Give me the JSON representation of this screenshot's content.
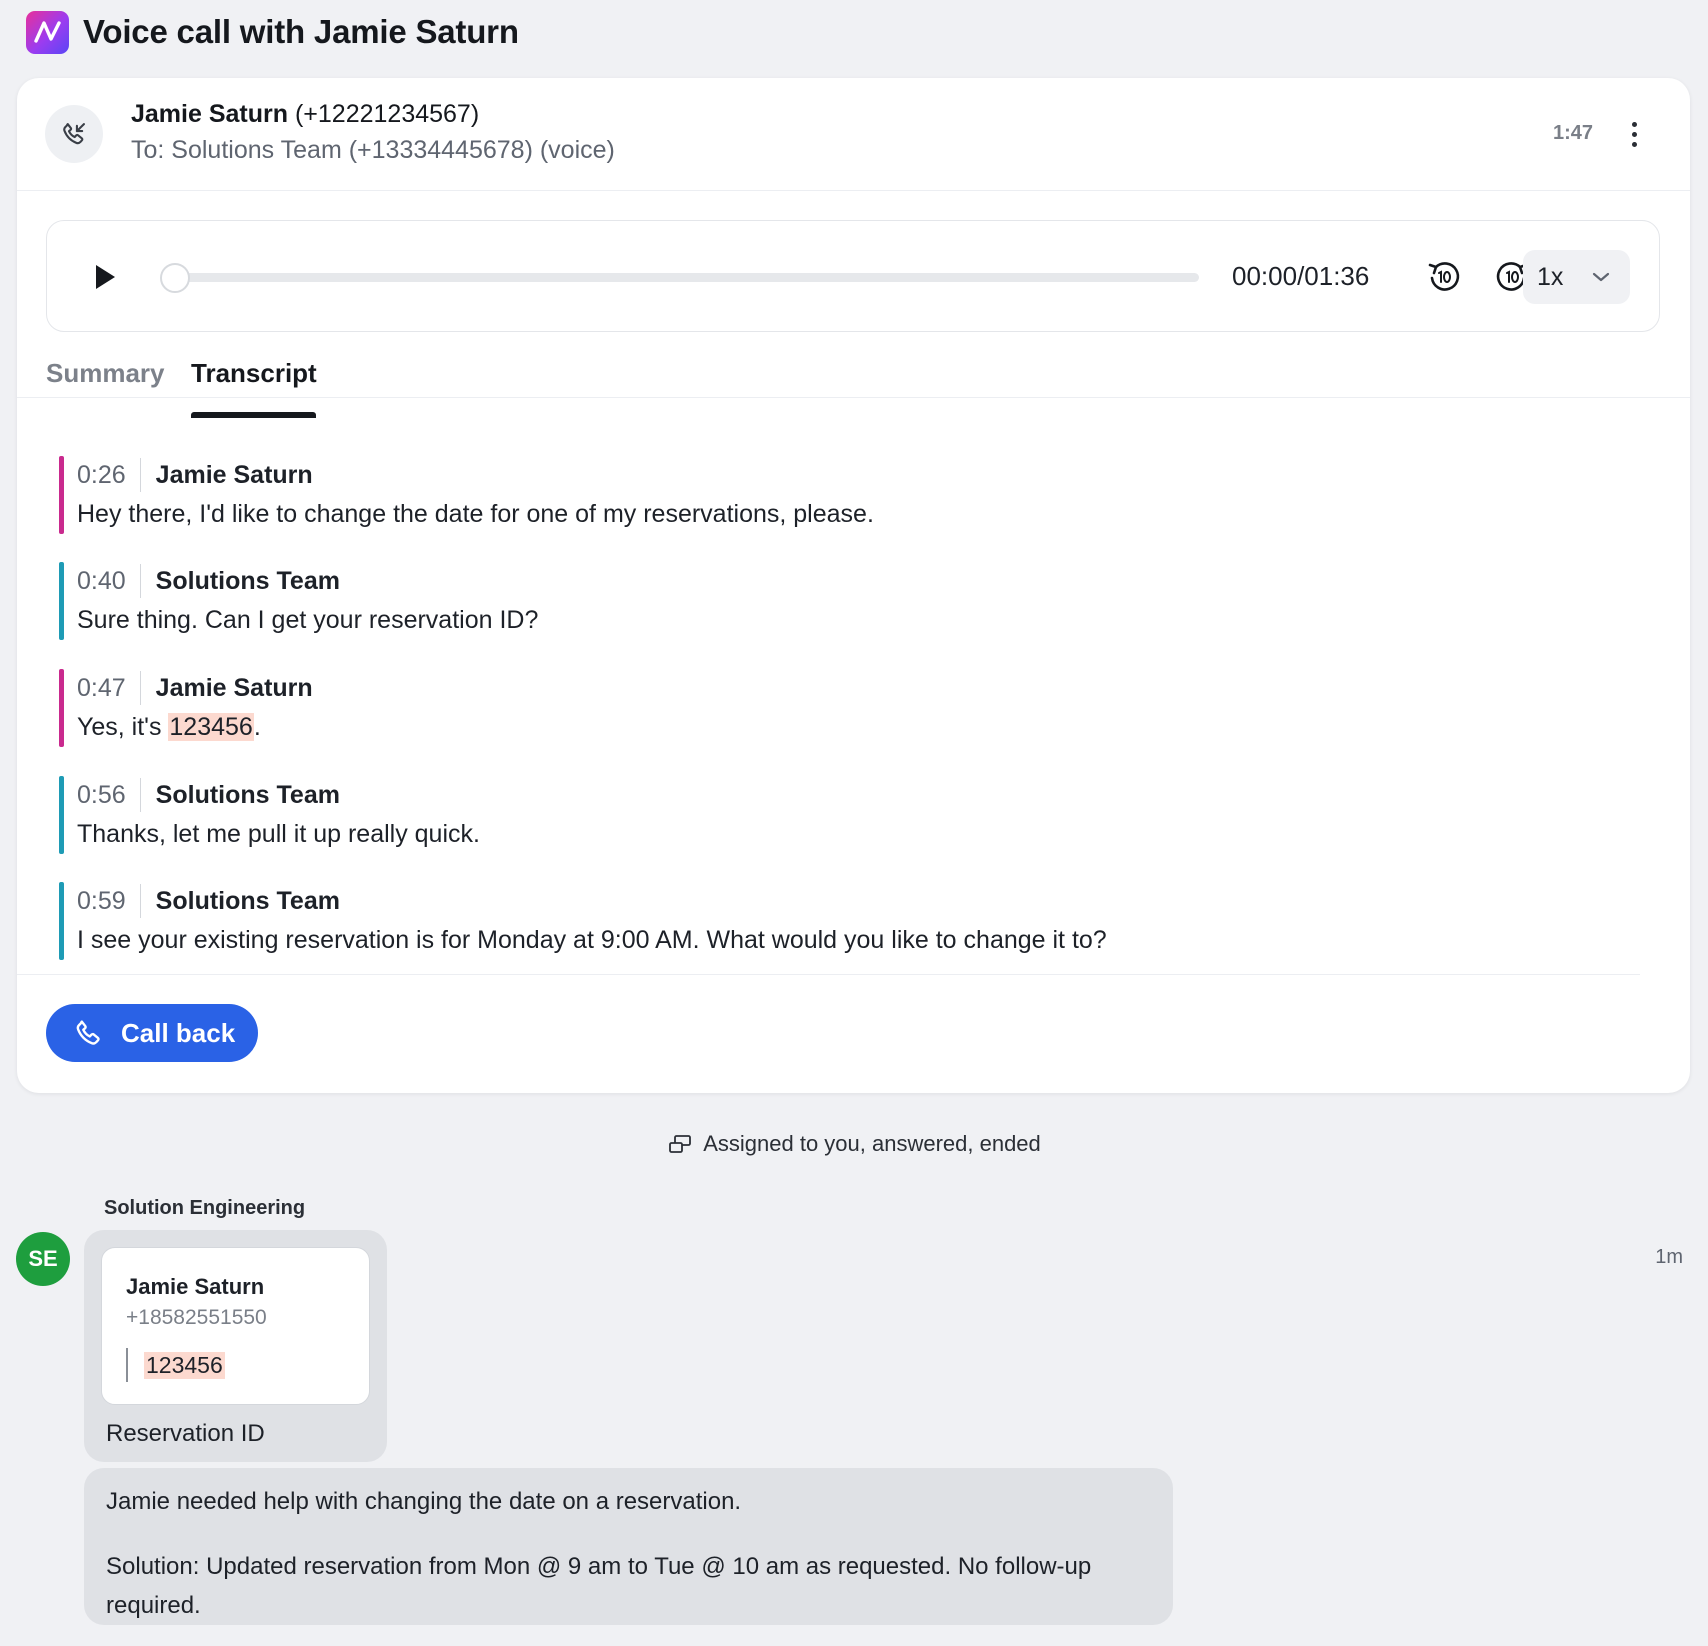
{
  "window": {
    "title": "Voice call with Jamie Saturn"
  },
  "call": {
    "caller_name": "Jamie Saturn",
    "caller_number": "(+12221234567)",
    "to_line": "To: Solutions Team (+13334445678) (voice)",
    "duration": "1:47"
  },
  "player": {
    "time_readout": "00:00/01:36",
    "progress_fraction": 0,
    "speed": "1x"
  },
  "tabs": [
    {
      "label": "Summary",
      "selected": false
    },
    {
      "label": "Transcript",
      "selected": true
    }
  ],
  "transcript": [
    {
      "time": "0:26",
      "speaker": "Jamie Saturn",
      "text": "Hey there, I'd like to change the date for one of my reservations, please."
    },
    {
      "time": "0:40",
      "speaker": "Solutions Team",
      "text": "Sure thing. Can I get your reservation ID?"
    },
    {
      "time": "0:47",
      "speaker": "Jamie Saturn",
      "text_before": "Yes, it's ",
      "highlight": "123456",
      "text_after": "."
    },
    {
      "time": "0:56",
      "speaker": "Solutions Team",
      "text": "Thanks, let me pull it up really quick."
    },
    {
      "time": "0:59",
      "speaker": "Solutions Team",
      "text": "I see your existing reservation is for Monday at 9:00 AM. What would you like to change it to?"
    }
  ],
  "actions": {
    "call_back_label": "Call back"
  },
  "status": {
    "text": "Assigned to you, answered, ended"
  },
  "message": {
    "team_label": "Solution Engineering",
    "avatar_initials": "SE",
    "time": "1m",
    "contact_name": "Jamie Saturn",
    "contact_phone": "+18582551550",
    "contact_value": "123456",
    "card_caption": "Reservation ID",
    "summary_line1": "Jamie needed help with changing the date on a reservation.",
    "summary_line2": "Solution: Updated reservation from Mon @ 9 am to Tue @ 10 am as requested. No follow-up required."
  },
  "colors": {
    "accent": "#2a62e6",
    "jamie_bar": "#c92a8e",
    "team_bar": "#1e9bb5",
    "highlight": "#fcd9cf",
    "avatar": "#1e9e3e"
  },
  "icons": {
    "logo": "app-logo-icon",
    "call": "incoming-call-icon",
    "more": "more-vertical-icon",
    "play": "play-icon",
    "skip_back": "rewind-10-icon",
    "skip_forward": "forward-10-icon",
    "speed_dropdown": "chevron-down-icon",
    "call_back": "phone-icon",
    "status": "transfer-icon"
  }
}
